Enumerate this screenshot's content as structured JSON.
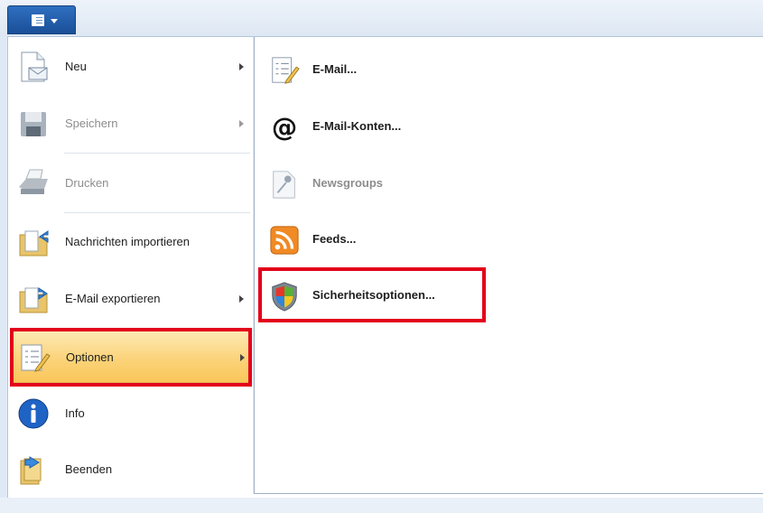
{
  "menu": {
    "items": [
      {
        "label": "Neu",
        "has_submenu": true,
        "disabled": false,
        "icon": "new-document-icon"
      },
      {
        "label": "Speichern",
        "has_submenu": true,
        "disabled": true,
        "icon": "floppy-disk-icon"
      },
      {
        "label": "Drucken",
        "has_submenu": false,
        "disabled": true,
        "icon": "printer-icon"
      },
      {
        "label": "Nachrichten importieren",
        "has_submenu": false,
        "disabled": false,
        "icon": "import-folder-icon"
      },
      {
        "label": "E-Mail exportieren",
        "has_submenu": true,
        "disabled": false,
        "icon": "export-folder-icon"
      },
      {
        "label": "Optionen",
        "has_submenu": true,
        "disabled": false,
        "selected": true,
        "icon": "options-checklist-icon"
      },
      {
        "label": "Info",
        "has_submenu": false,
        "disabled": false,
        "icon": "info-icon"
      },
      {
        "label": "Beenden",
        "has_submenu": false,
        "disabled": false,
        "icon": "exit-icon"
      }
    ]
  },
  "submenu": {
    "items": [
      {
        "label": "E-Mail...",
        "disabled": false,
        "icon": "mail-options-icon"
      },
      {
        "label": "E-Mail-Konten...",
        "disabled": false,
        "icon": "at-sign-icon"
      },
      {
        "label": "Newsgroups",
        "disabled": true,
        "icon": "newsgroups-icon"
      },
      {
        "label": "Feeds...",
        "disabled": false,
        "icon": "rss-feed-icon"
      },
      {
        "label": "Sicherheitsoptionen...",
        "disabled": false,
        "icon": "security-shield-icon"
      }
    ]
  },
  "colors": {
    "highlight_box": "#e3001b",
    "selected_item": "#fbd37a",
    "app_button": "#1a4f98"
  }
}
